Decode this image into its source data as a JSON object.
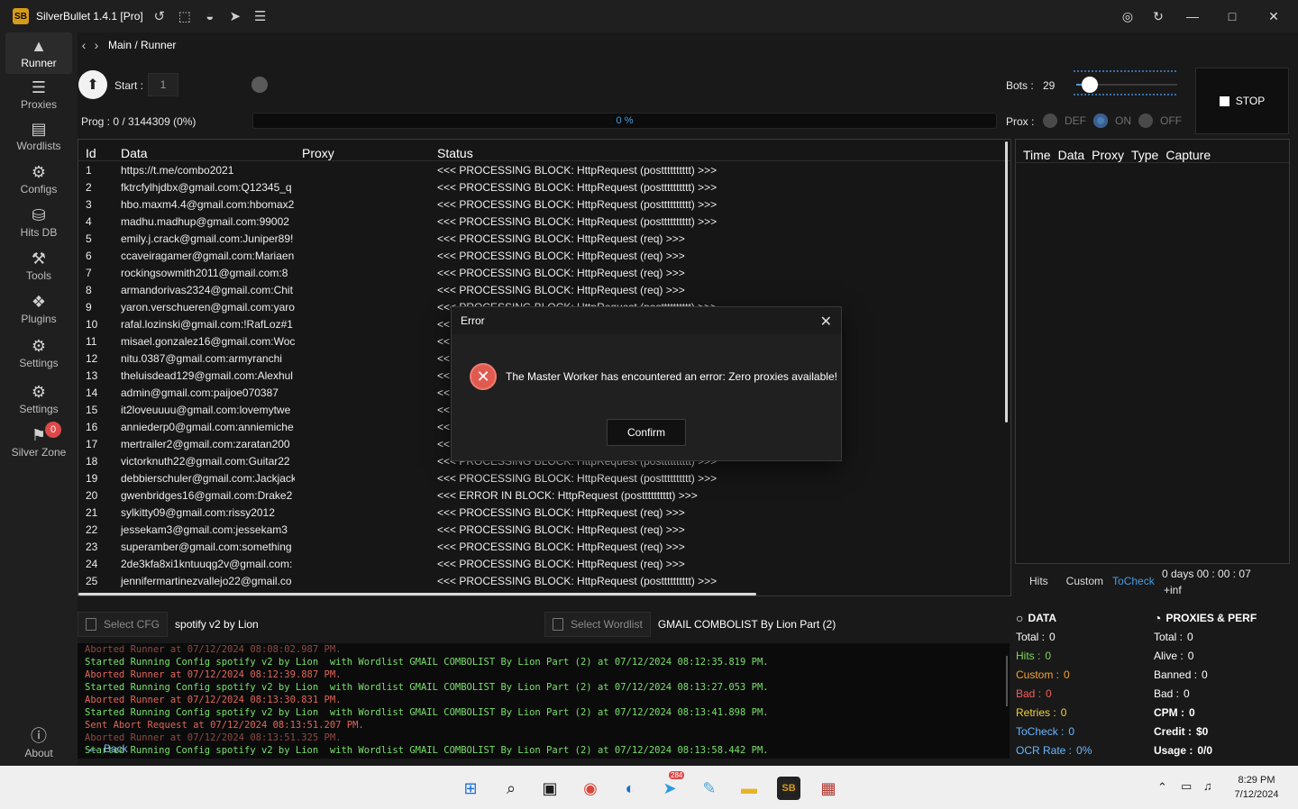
{
  "app": {
    "title": "SilverBullet 1.4.1 [Pro]",
    "logo_text": "SB"
  },
  "breadcrumb": "Main / Runner",
  "sidebar": [
    {
      "label": "Runner",
      "icon": "user-icon"
    },
    {
      "label": "Proxies",
      "icon": "server-icon"
    },
    {
      "label": "Wordlists",
      "icon": "files-icon"
    },
    {
      "label": "Configs",
      "icon": "gear-icon"
    },
    {
      "label": "Hits DB",
      "icon": "database-icon"
    },
    {
      "label": "Tools",
      "icon": "tools-icon"
    },
    {
      "label": "Plugins",
      "icon": "puzzle-icon"
    },
    {
      "label": "Settings",
      "icon": "settings-gears-icon"
    },
    {
      "label": "Settings",
      "icon": "core-settings-icon"
    },
    {
      "label": "Silver Zone",
      "icon": "location-icon",
      "badge": "0"
    }
  ],
  "about_label": "About",
  "runner": {
    "start_label": "Start :",
    "start_value": "1",
    "bots_label": "Bots :",
    "bots_value": "29",
    "prog_label": "Prog : 0 / 3144309 (0%)",
    "prog_percent_text": "0 %",
    "progress_fraction": 0,
    "prox_label": "Prox :",
    "prox_options": [
      "DEF",
      "ON",
      "OFF"
    ],
    "prox_selected": "ON",
    "stop_label": "STOP"
  },
  "table": {
    "columns": [
      "Id",
      "Data",
      "Proxy",
      "Status"
    ],
    "rows": [
      {
        "id": "1",
        "data": "https://t.me/combo2021",
        "proxy": "",
        "status": "<<< PROCESSING BLOCK: HttpRequest (postttttttttt) >>>"
      },
      {
        "id": "2",
        "data": "fktrcfylhjdbx@gmail.com:Q12345_q",
        "proxy": "",
        "status": "<<< PROCESSING BLOCK: HttpRequest (postttttttttt) >>>"
      },
      {
        "id": "3",
        "data": "hbo.maxm4.4@gmail.com:hbomax2",
        "proxy": "",
        "status": "<<< PROCESSING BLOCK: HttpRequest (postttttttttt) >>>"
      },
      {
        "id": "4",
        "data": "madhu.madhup@gmail.com:99002",
        "proxy": "",
        "status": "<<< PROCESSING BLOCK: HttpRequest (postttttttttt) >>>"
      },
      {
        "id": "5",
        "data": "emily.j.crack@gmail.com:Juniper89!",
        "proxy": "",
        "status": "<<< PROCESSING BLOCK: HttpRequest (req) >>>"
      },
      {
        "id": "6",
        "data": "ccaveiragamer@gmail.com:Mariaen",
        "proxy": "",
        "status": "<<< PROCESSING BLOCK: HttpRequest (req) >>>"
      },
      {
        "id": "7",
        "data": "rockingsowmith2011@gmail.com:8",
        "proxy": "",
        "status": "<<< PROCESSING BLOCK: HttpRequest (req) >>>"
      },
      {
        "id": "8",
        "data": "armandorivas2324@gmail.com:Chit",
        "proxy": "",
        "status": "<<< PROCESSING BLOCK: HttpRequest (req) >>>"
      },
      {
        "id": "9",
        "data": "yaron.verschueren@gmail.com:yaro",
        "proxy": "",
        "status": "<<< PROCESSING BLOCK: HttpRequest (postttttttttt) >>>"
      },
      {
        "id": "10",
        "data": "rafal.lozinski@gmail.com:!RafLoz#1",
        "proxy": "",
        "status": "<<"
      },
      {
        "id": "11",
        "data": "misael.gonzalez16@gmail.com:Woc",
        "proxy": "",
        "status": "<<"
      },
      {
        "id": "12",
        "data": "nitu.0387@gmail.com:armyranchi",
        "proxy": "",
        "status": "<<"
      },
      {
        "id": "13",
        "data": "theluisdead129@gmail.com:Alexhul",
        "proxy": "",
        "status": "<<"
      },
      {
        "id": "14",
        "data": "admin@gmail.com:paijoe070387",
        "proxy": "",
        "status": "<<"
      },
      {
        "id": "15",
        "data": "it2loveuuuu@gmail.com:lovemytwe",
        "proxy": "",
        "status": "<<"
      },
      {
        "id": "16",
        "data": "anniederp0@gmail.com:anniemiche",
        "proxy": "",
        "status": "<<"
      },
      {
        "id": "17",
        "data": "mertrailer2@gmail.com:zaratan200",
        "proxy": "",
        "status": "<<"
      },
      {
        "id": "18",
        "data": "victorknuth22@gmail.com:Guitar22",
        "proxy": "",
        "status": "<<< PROCESSING BLOCK: HttpRequest (postttttttttt) >>>"
      },
      {
        "id": "19",
        "data": "debbierschuler@gmail.com:Jackjack",
        "proxy": "",
        "status": "<<< PROCESSING BLOCK: HttpRequest (postttttttttt) >>>"
      },
      {
        "id": "20",
        "data": "gwenbridges16@gmail.com:Drake2",
        "proxy": "",
        "status": "<<< ERROR IN BLOCK: HttpRequest (postttttttttt) >>>"
      },
      {
        "id": "21",
        "data": "sylkitty09@gmail.com:rissy2012",
        "proxy": "",
        "status": "<<< PROCESSING BLOCK: HttpRequest (req) >>>"
      },
      {
        "id": "22",
        "data": "jessekam3@gmail.com:jessekam3",
        "proxy": "",
        "status": "<<< PROCESSING BLOCK: HttpRequest (req) >>>"
      },
      {
        "id": "23",
        "data": "superamber@gmail.com:something",
        "proxy": "",
        "status": "<<< PROCESSING BLOCK: HttpRequest (req) >>>"
      },
      {
        "id": "24",
        "data": "2de3kfa8xi1kntuuqg2v@gmail.com:",
        "proxy": "",
        "status": "<<< PROCESSING BLOCK: HttpRequest (req) >>>"
      },
      {
        "id": "25",
        "data": "jennifermartinezvallejo22@gmail.co",
        "proxy": "",
        "status": "<<< PROCESSING BLOCK: HttpRequest (postttttttttt) >>>"
      }
    ]
  },
  "hits_panel": {
    "columns": [
      "Time",
      "Data",
      "Proxy",
      "Type",
      "Capture"
    ],
    "tabs": [
      "Hits",
      "Custom",
      "ToCheck"
    ],
    "active_tab": "ToCheck",
    "elapsed": "0 days 00 : 00 : 07",
    "eta": "+inf"
  },
  "modal": {
    "title": "Error",
    "message": "The Master Worker has encountered an error: Zero proxies available!",
    "confirm_label": "Confirm"
  },
  "config_bar": {
    "select_cfg_label": "Select CFG",
    "cfg_name": "spotify v2 by Lion",
    "select_wordlist_label": "Select Wordlist",
    "wordlist_name": "GMAIL COMBOLIST By Lion Part (2)"
  },
  "log": [
    {
      "text": "Aborted Runner at 07/12/2024 08:08:02.987 PM.",
      "kind": "dim"
    },
    {
      "text": "Started Running Config spotify v2 by Lion  with Wordlist GMAIL COMBOLIST By Lion Part (2) at 07/12/2024 08:12:35.819 PM.",
      "kind": "g"
    },
    {
      "text": "Aborted Runner at 07/12/2024 08:12:39.887 PM.",
      "kind": "r"
    },
    {
      "text": "Started Running Config spotify v2 by Lion  with Wordlist GMAIL COMBOLIST By Lion Part (2) at 07/12/2024 08:13:27.053 PM.",
      "kind": "g"
    },
    {
      "text": "Aborted Runner at 07/12/2024 08:13:30.831 PM.",
      "kind": "r"
    },
    {
      "text": "Started Running Config spotify v2 by Lion  with Wordlist GMAIL COMBOLIST By Lion Part (2) at 07/12/2024 08:13:41.898 PM.",
      "kind": "g"
    },
    {
      "text": "Sent Abort Request at 07/12/2024 08:13:51.207 PM.",
      "kind": "r"
    },
    {
      "text": "Aborted Runner at 07/12/2024 08:13:51.325 PM.",
      "kind": "dim"
    },
    {
      "text": "Started Running Config spotify v2 by Lion  with Wordlist GMAIL COMBOLIST By Lion Part (2) at 07/12/2024 08:13:58.442 PM.",
      "kind": "g"
    }
  ],
  "back_label": "Back",
  "data_stats": {
    "title": "DATA",
    "items": [
      {
        "label": "Total :",
        "value": "0",
        "color": "#ffffff"
      },
      {
        "label": "Hits :",
        "value": "0",
        "color": "#7ed957"
      },
      {
        "label": "Custom :",
        "value": "0",
        "color": "#f0a23a"
      },
      {
        "label": "Bad :",
        "value": "0",
        "color": "#f0605a"
      },
      {
        "label": "Retries :",
        "value": "0",
        "color": "#f0d23a"
      },
      {
        "label": "ToCheck :",
        "value": "0",
        "color": "#69b7ff"
      },
      {
        "label": "OCR Rate :",
        "value": "0%",
        "color": "#69b7ff"
      }
    ]
  },
  "perf_stats": {
    "title": "PROXIES & PERF",
    "items": [
      {
        "label": "Total :",
        "value": "0",
        "bold": false
      },
      {
        "label": "Alive :",
        "value": "0",
        "bold": false
      },
      {
        "label": "Banned :",
        "value": "0",
        "bold": false
      },
      {
        "label": "Bad :",
        "value": "0",
        "bold": false
      },
      {
        "label": "CPM :",
        "value": "0",
        "bold": true
      },
      {
        "label": "Credit :",
        "value": "$0",
        "bold": true
      },
      {
        "label": "Usage :",
        "value": "0/0",
        "bold": true
      }
    ]
  },
  "taskbar": {
    "time": "8:29 PM",
    "date": "7/12/2024",
    "telegram_badge": "284",
    "apps": [
      "windows-start-icon",
      "search-icon",
      "task-view-icon",
      "chrome-icon",
      "edge-icon",
      "telegram-icon",
      "notepad-icon",
      "folder-icon",
      "silverbullet-icon",
      "winrar-icon"
    ]
  },
  "colors": {
    "accent": "#4a9de0",
    "error": "#e05a4f",
    "bg": "#191919"
  }
}
